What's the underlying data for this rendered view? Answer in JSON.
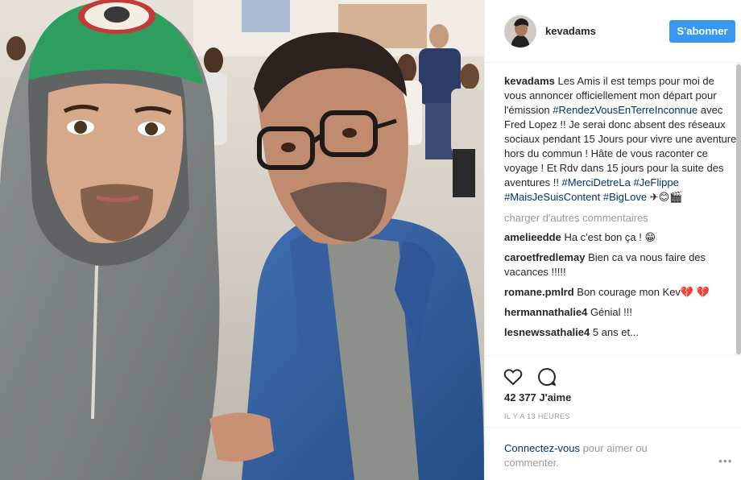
{
  "post": {
    "username": "kevadams",
    "follow_label": "S'abonner",
    "caption": {
      "user": "kevadams",
      "parts": [
        {
          "type": "text",
          "value": "Les Amis il est temps pour moi de vous annoncer officiellement mon départ pour l'émission "
        },
        {
          "type": "tag",
          "value": "#RendezVousEnTerreInconnue"
        },
        {
          "type": "text",
          "value": " avec Fred Lopez !! Je serai donc absent des réseaux sociaux pendant 15 Jours pour vivre une aventure hors du commun ! Hâte de vous raconter ce voyage ! Et Rdv dans 15 jours pour la suite des aventures !! "
        },
        {
          "type": "tag",
          "value": "#MerciDetreLa"
        },
        {
          "type": "text",
          "value": " "
        },
        {
          "type": "tag",
          "value": "#JeFlippe"
        },
        {
          "type": "text",
          "value": " "
        },
        {
          "type": "tag",
          "value": "#MaisJeSuisContent"
        },
        {
          "type": "text",
          "value": " "
        },
        {
          "type": "tag",
          "value": "#BigLove"
        },
        {
          "type": "text",
          "value": " ✈😊🎬"
        }
      ]
    },
    "load_more_label": "charger d'autres commentaires",
    "comments": [
      {
        "user": "amelieedde",
        "text": "Ha c'est bon ça ! 😁"
      },
      {
        "user": "caroetfredlemay",
        "text": "Bien ca va nous faire des vacances !!!!!"
      },
      {
        "user": "romane.pmlrd",
        "text": "Bon courage mon Kev💔 💔"
      },
      {
        "user": "hermannathalie4",
        "text": "Génial !!!"
      },
      {
        "user": "lesnewssathalie4",
        "text": "5 ans et..."
      }
    ],
    "like_icon": "heart-outline-icon",
    "comment_icon": "speech-bubble-icon",
    "likes": "42 377 J'aime",
    "timestamp": "IL Y A 13 HEURES",
    "login": {
      "link": "Connectez-vous",
      "rest": " pour aimer ou commenter."
    },
    "more_label": "•••"
  },
  "colors": {
    "accent": "#3897f0",
    "hashtag": "#003569",
    "muted": "#999999",
    "text": "#262626"
  }
}
